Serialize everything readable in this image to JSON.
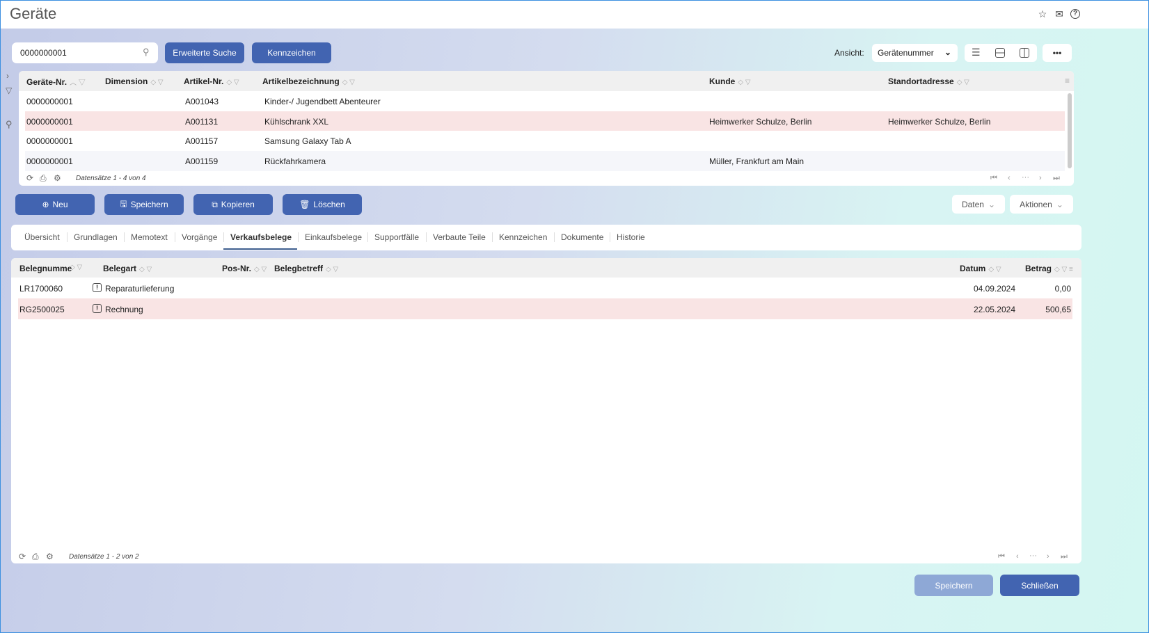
{
  "title": "Geräte",
  "header_icons": [
    "star-icon",
    "mail-icon",
    "help-icon"
  ],
  "search": {
    "value": "0000000001"
  },
  "toolbar": {
    "extended_search": "Erweiterte Suche",
    "kennzeichen": "Kennzeichen",
    "view_label": "Ansicht:",
    "view_value": "Gerätenummer"
  },
  "top_grid": {
    "columns": [
      "Geräte-Nr.",
      "Dimension",
      "Artikel-Nr.",
      "Artikelbezeichnung",
      "Kunde",
      "Standortadresse"
    ],
    "rows": [
      [
        "0000000001",
        "",
        "A001043",
        "Kinder-/ Jugendbett Abenteurer",
        "",
        ""
      ],
      [
        "0000000001",
        "",
        "A001131",
        "Kühlschrank XXL",
        "Heimwerker Schulze, Berlin",
        "Heimwerker Schulze, Berlin"
      ],
      [
        "0000000001",
        "",
        "A001157",
        "Samsung Galaxy Tab A",
        "",
        ""
      ],
      [
        "0000000001",
        "",
        "A001159",
        "Rückfahrkamera",
        "Müller, Frankfurt am Main",
        ""
      ]
    ],
    "footer": "Datensätze 1 - 4 von 4"
  },
  "actions": {
    "new": "Neu",
    "save": "Speichern",
    "copy": "Kopieren",
    "delete": "Löschen",
    "data": "Daten",
    "actions": "Aktionen"
  },
  "tabs": [
    "Übersicht",
    "Grundlagen",
    "Memotext",
    "Vorgänge",
    "Verkaufsbelege",
    "Einkaufsbelege",
    "Supportfälle",
    "Verbaute Teile",
    "Kennzeichen",
    "Dokumente",
    "Historie"
  ],
  "active_tab": "Verkaufsbelege",
  "bottom_grid": {
    "columns": [
      "Belegnumme",
      "Belegart",
      "Pos-Nr.",
      "Belegbetreff",
      "Datum",
      "Betrag"
    ],
    "rows": [
      [
        "LR1700060",
        "Reparaturlieferung",
        "",
        "",
        "04.09.2024",
        "0,00"
      ],
      [
        "RG2500025",
        "Rechnung",
        "",
        "",
        "22.05.2024",
        "500,65"
      ]
    ],
    "footer": "Datensätze 1 - 2 von 2"
  },
  "footer_buttons": {
    "save": "Speichern",
    "close": "Schließen"
  },
  "colors": {
    "primary": "#4264b1",
    "selected_row": "#f9e4e4",
    "disabled": "#8ea8d6"
  }
}
